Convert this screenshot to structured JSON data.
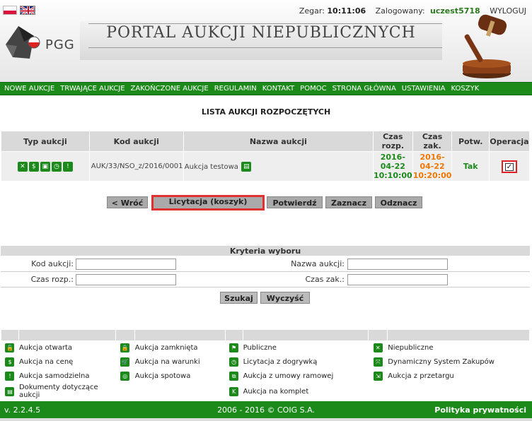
{
  "header": {
    "clock_label": "Zegar:",
    "clock_value": "10:11:06",
    "logged_label": "Zalogowany:",
    "username": "uczest5718",
    "logout": "WYLOGUJ",
    "logo_text": "PGG",
    "portal_title": "PORTAL AUKCJI NIEPUBLICZNYCH"
  },
  "nav": [
    "NOWE AUKCJE",
    "TRWAJĄCE AUKCJE",
    "ZAKOŃCZONE AUKCJE",
    "REGULAMIN",
    "KONTAKT",
    "POMOC",
    "STRONA GŁÓWNA",
    "USTAWIENIA",
    "KOSZYK"
  ],
  "page_title": "LISTA AUKCJI ROZPOCZĘTYCH",
  "table": {
    "headers": {
      "type": "Typ aukcji",
      "code": "Kod aukcji",
      "name": "Nazwa aukcji",
      "start_1": "Czas",
      "start_2": "rozp.",
      "end_1": "Czas",
      "end_2": "zak.",
      "confirm": "Potw.",
      "operation": "Operacja"
    },
    "row": {
      "type_icons": [
        "x-icon",
        "dollar-icon",
        "lock-icon",
        "clock-icon",
        "exclamation-icon"
      ],
      "code": "AUK/33/NSO_z/2016/0001",
      "name": "Aukcja testowa",
      "start_date": "2016-",
      "start_date2": "04-22",
      "start_time": "10:10:00",
      "end_date": "2016-",
      "end_date2": "04-22",
      "end_time": "10:20:00",
      "confirmed": "Tak",
      "checked": true
    }
  },
  "buttons": {
    "back": "< Wróć",
    "bidding": "Licytacja (koszyk)",
    "confirm": "Potwierdź",
    "select": "Zaznacz",
    "deselect": "Odznacz",
    "search": "Szukaj",
    "clear": "Wyczyść"
  },
  "criteria": {
    "title": "Kryteria wyboru",
    "code_label": "Kod aukcji:",
    "name_label": "Nazwa aukcji:",
    "start_label": "Czas rozp.:",
    "end_label": "Czas zak.:",
    "code_value": "",
    "name_value": "",
    "start_value": "",
    "end_value": ""
  },
  "legend": {
    "rows": [
      [
        {
          "icon": "unlock-icon",
          "g": "🔓",
          "label": "Aukcja otwarta"
        },
        {
          "icon": "lock-icon",
          "g": "🔒",
          "label": "Aukcja zamknięta"
        },
        {
          "icon": "flag-icon",
          "g": "⚑",
          "label": "Publiczne"
        },
        {
          "icon": "x-icon",
          "g": "✕",
          "label": "Niepubliczne"
        }
      ],
      [
        {
          "icon": "dollar-icon",
          "g": "$",
          "label": "Aukcja na cenę"
        },
        {
          "icon": "cart-icon",
          "g": "🛒",
          "label": "Aukcja na warunki"
        },
        {
          "icon": "clock-icon",
          "g": "◷",
          "label": "Licytacja z dogrywką"
        },
        {
          "icon": "arrows-icon",
          "g": "⤧",
          "label": "Dynamiczny System Zakupów"
        }
      ],
      [
        {
          "icon": "exclamation-icon",
          "g": "!",
          "label": "Aukcja samodzielna"
        },
        {
          "icon": "spot-icon",
          "g": "◎",
          "label": "Aukcja spotowa"
        },
        {
          "icon": "frame-icon",
          "g": "⧉",
          "label": "Aukcja z umowy ramowej"
        },
        {
          "icon": "tender-icon",
          "g": "⇲",
          "label": "Aukcja z przetargu"
        }
      ],
      [
        {
          "icon": "document-icon",
          "g": "▤",
          "label": "Dokumenty dotyczące aukcji"
        },
        null,
        {
          "icon": "k-icon",
          "g": "K",
          "label": "Aukcja na komplet"
        },
        null
      ]
    ]
  },
  "footer": {
    "version": "v. 2.2.4.5",
    "copyright": "2006 - 2016 © COIG S.A.",
    "privacy": "Polityka prywatności"
  },
  "colors": {
    "green": "#1b8a1b",
    "orange": "#ee7700",
    "highlight": "#e03030"
  }
}
